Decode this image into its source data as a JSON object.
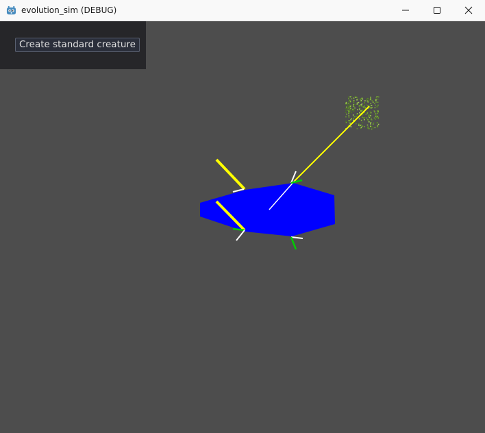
{
  "window": {
    "title": "evolution_sim (DEBUG)",
    "controls": {
      "minimize_icon": "minimize-icon",
      "maximize_icon": "maximize-icon",
      "close_icon": "close-icon"
    }
  },
  "ui_panel": {
    "create_button_label": "Create standard creature"
  },
  "colors": {
    "background": "#4d4d4d",
    "panel": "#262629",
    "creature_body": "#0000ff",
    "muscle": "#ffff00",
    "sensor": "#ffffff",
    "joint": "#00cc00",
    "food": "#6fa32a"
  }
}
